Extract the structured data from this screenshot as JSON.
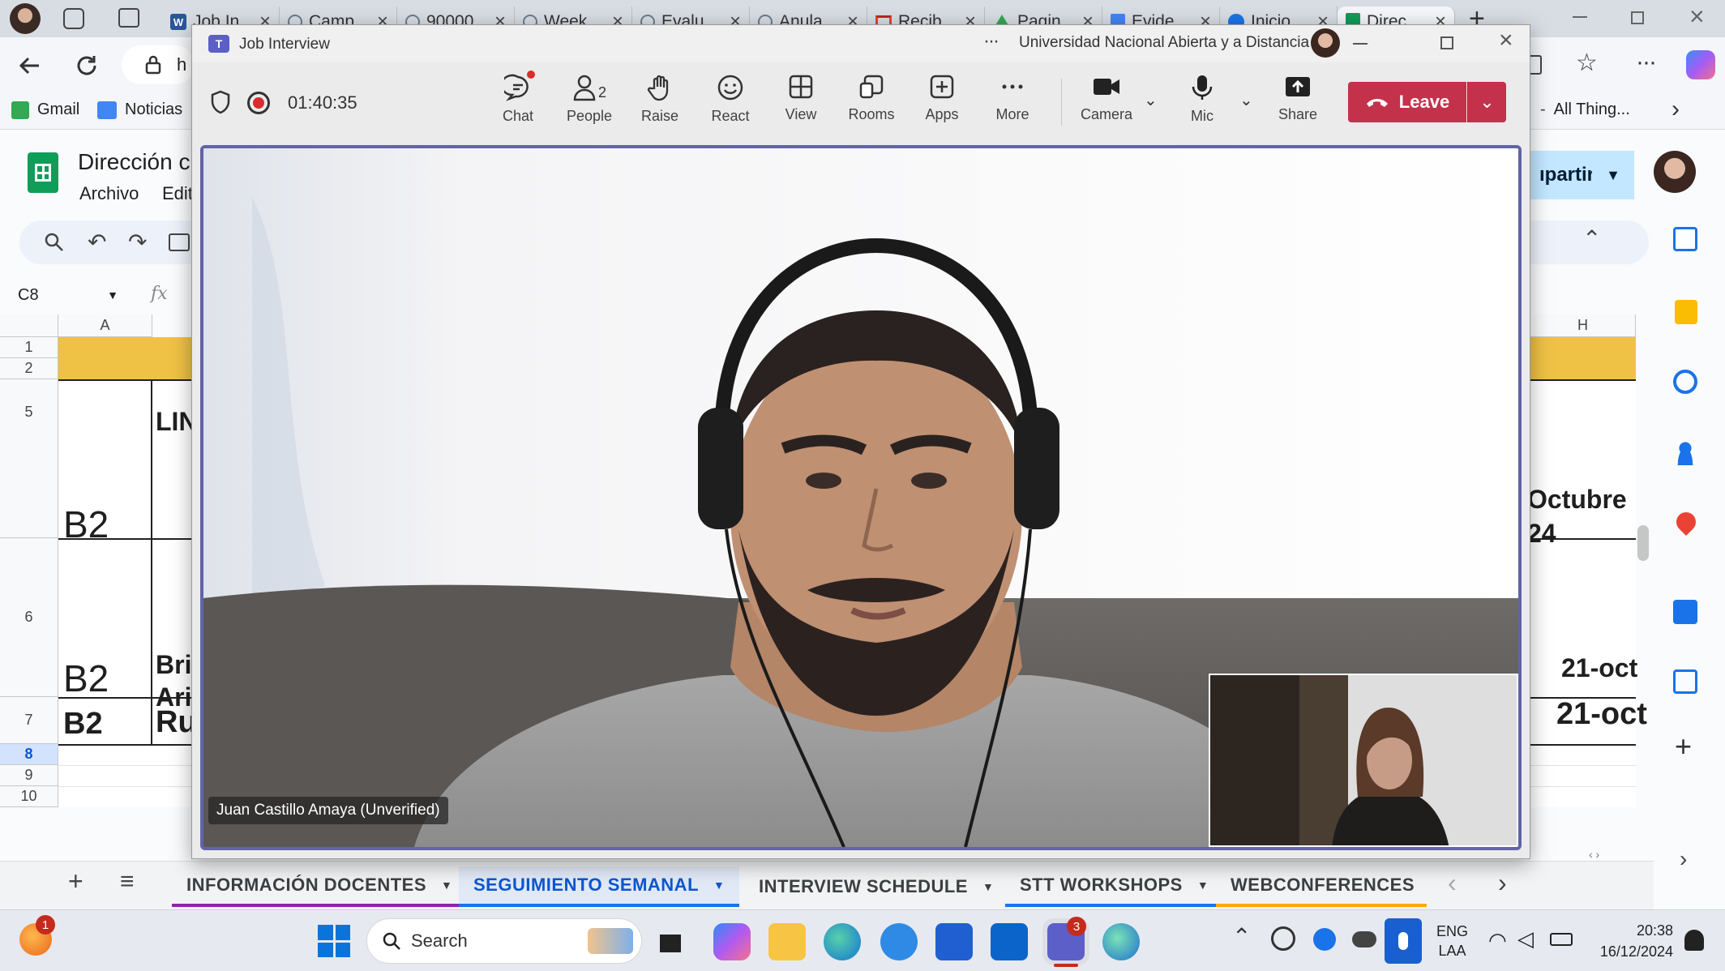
{
  "browser": {
    "tabs": [
      {
        "label": "Job In"
      },
      {
        "label": "Camp"
      },
      {
        "label": "90000"
      },
      {
        "label": "Week"
      },
      {
        "label": "Evalu"
      },
      {
        "label": "Anula"
      },
      {
        "label": "Recib"
      },
      {
        "label": "Pagin"
      },
      {
        "label": "Evide"
      },
      {
        "label": "Inicio"
      },
      {
        "label": "Direc"
      }
    ],
    "bookmarks": [
      {
        "label": "Gmail"
      },
      {
        "label": "Noticias"
      }
    ],
    "bookmarks_right": "All Thing...",
    "address_partial": "h"
  },
  "sheets": {
    "title": "Dirección c",
    "menu": [
      "Archivo",
      "Edit"
    ],
    "share_label": "ıpartir",
    "cell_ref": "C8",
    "fx": "fx",
    "col_a": "A",
    "col_h": "H",
    "row_numbers": [
      "1",
      "2",
      "5",
      "6",
      "7",
      "8",
      "9",
      "10"
    ],
    "cells": {
      "r5_a": "B2",
      "r5_b": "LIN",
      "r5_h1": "Octubre",
      "r5_h2": "24",
      "r6_a": "B2",
      "r6_b1": "Bri",
      "r6_b2": "Ari",
      "r6_h": "21-oct",
      "r7_a": "B2",
      "r7_b": "Ru",
      "r7_h": "21-oct"
    },
    "sheet_tabs": [
      {
        "label": "INFORMACIÓN DOCENTES",
        "active": false,
        "color": "#8e24aa"
      },
      {
        "label": "SEGUIMIENTO SEMANAL",
        "active": true,
        "color": "#1a73e8"
      },
      {
        "label": "INTERVIEW SCHEDULE",
        "active": false,
        "color": ""
      },
      {
        "label": "STT WORKSHOPS",
        "active": false,
        "color": "#1a73e8"
      },
      {
        "label": "WEBCONFERENCES",
        "active": false,
        "color": "#f9ab00"
      }
    ]
  },
  "teams": {
    "window_title": "Job Interview",
    "org": "Universidad Nacional Abierta y a Distancia",
    "timer": "01:40:35",
    "toolbar": [
      {
        "label": "Chat",
        "icon": "chat-icon"
      },
      {
        "label": "People",
        "icon": "people-icon",
        "count": "2"
      },
      {
        "label": "Raise",
        "icon": "raise-hand-icon"
      },
      {
        "label": "React",
        "icon": "react-icon"
      },
      {
        "label": "View",
        "icon": "view-icon"
      },
      {
        "label": "Rooms",
        "icon": "rooms-icon"
      },
      {
        "label": "Apps",
        "icon": "apps-icon"
      },
      {
        "label": "More",
        "icon": "more-icon"
      }
    ],
    "camera_label": "Camera",
    "mic_label": "Mic",
    "share_label": "Share",
    "leave_label": "Leave",
    "participant_name": "Juan Castillo Amaya (Unverified)"
  },
  "taskbar": {
    "search_placeholder": "Search",
    "notif_badge": "1",
    "teams_badge": "3",
    "lang1": "ENG",
    "lang2": "LAA",
    "time": "20:38",
    "date": "16/12/2024"
  }
}
